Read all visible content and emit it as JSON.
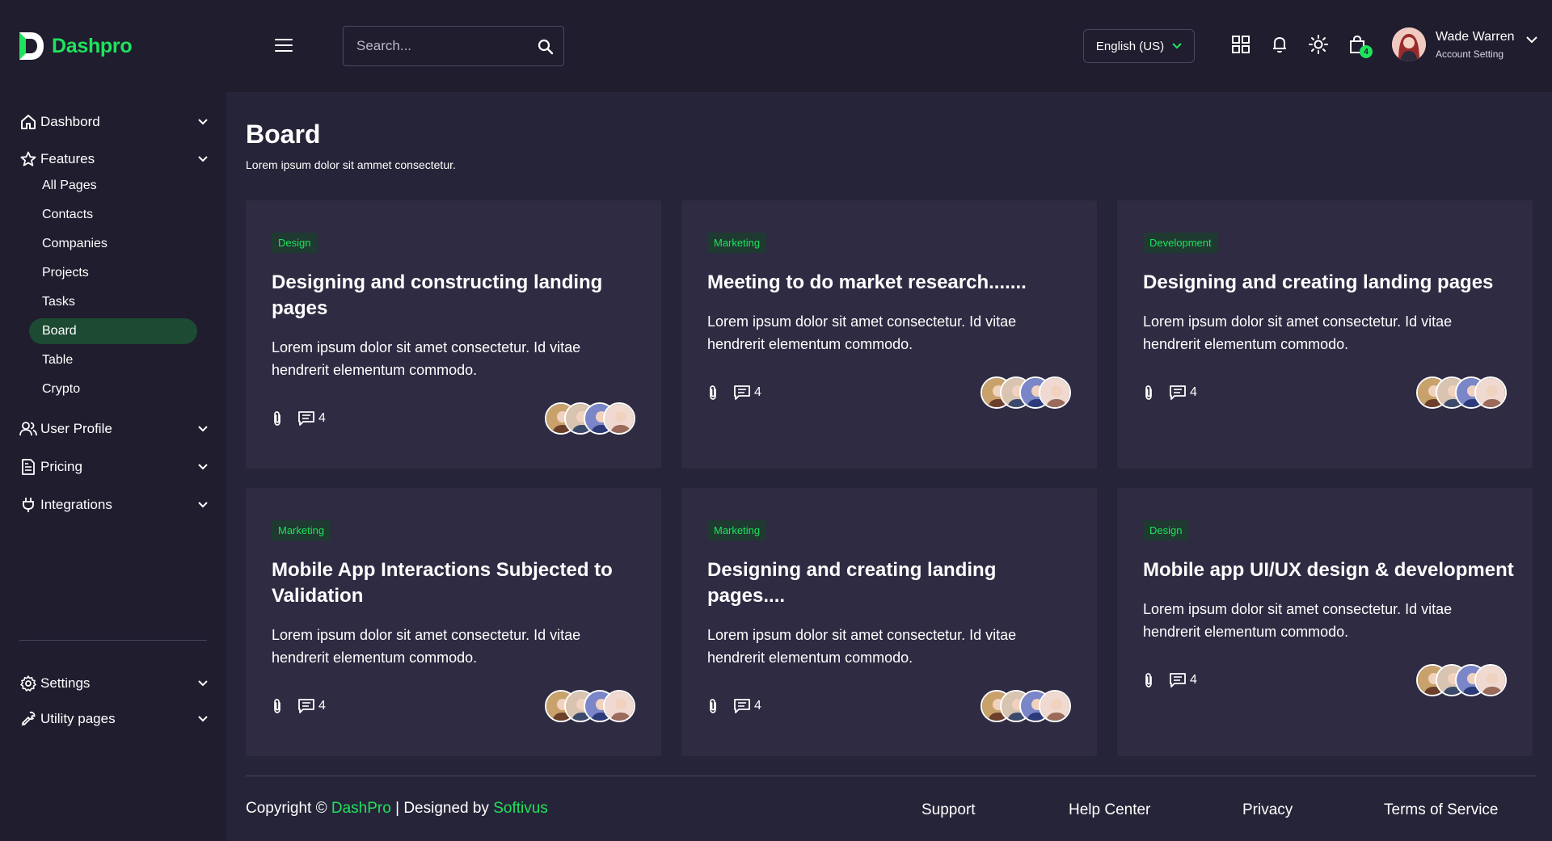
{
  "brand": {
    "name": "Dashpro",
    "accent": "#1ee35c"
  },
  "search": {
    "placeholder": "Search..."
  },
  "language": {
    "selected": "English (US)"
  },
  "notifications": {
    "cart_count": "4"
  },
  "user": {
    "name": "Wade Warren",
    "subtitle": "Account Setting"
  },
  "sidebar": {
    "items": [
      {
        "label": "Dashbord",
        "icon": "home-icon"
      },
      {
        "label": "Features",
        "icon": "star-icon"
      },
      {
        "label": "User Profile",
        "icon": "users-icon"
      },
      {
        "label": "Pricing",
        "icon": "document-icon"
      },
      {
        "label": "Integrations",
        "icon": "plug-icon"
      },
      {
        "label": "Settings",
        "icon": "gear-icon"
      },
      {
        "label": "Utility pages",
        "icon": "wrench-icon"
      }
    ],
    "features_sub": [
      "All Pages",
      "Contacts",
      "Companies",
      "Projects",
      "Tasks",
      "Board",
      "Table",
      "Crypto"
    ],
    "active_sub": "Board"
  },
  "page": {
    "title": "Board",
    "subtitle": "Lorem ipsum dolor sit ammet consectetur."
  },
  "cards": [
    {
      "tag": "Design",
      "title": "Designing and constructing landing pages",
      "desc": "Lorem ipsum dolor sit amet consectetur. Id vitae hendrerit elementum commodo.",
      "comments": "4"
    },
    {
      "tag": "Marketing",
      "title": "Meeting to do market research.......",
      "desc": "Lorem ipsum dolor sit amet consectetur. Id vitae hendrerit elementum commodo.",
      "comments": "4"
    },
    {
      "tag": "Development",
      "title": "Designing and creating landing pages",
      "desc": "Lorem ipsum dolor sit amet consectetur. Id vitae hendrerit elementum commodo.",
      "comments": "4"
    },
    {
      "tag": "Marketing",
      "title": "Mobile App Interactions Subjected to Validation",
      "desc": "Lorem ipsum dolor sit amet consectetur. Id vitae hendrerit elementum commodo.",
      "comments": "4"
    },
    {
      "tag": "Marketing",
      "title": "Designing and creating landing pages....",
      "desc": "Lorem ipsum dolor sit amet consectetur. Id vitae hendrerit elementum commodo.",
      "comments": "4"
    },
    {
      "tag": "Design",
      "title": "Mobile app UI/UX design & development",
      "desc": "Lorem ipsum dolor sit amet consectetur. Id vitae hendrerit elementum commodo.",
      "comments": "4"
    }
  ],
  "footer": {
    "copyright_prefix": "Copyright ©",
    "brand": "DashPro",
    "separator": "|",
    "designed_by": "Designed by",
    "designer": "Softivus",
    "links": [
      "Support",
      "Help Center",
      "Privacy",
      "Terms of Service"
    ]
  }
}
